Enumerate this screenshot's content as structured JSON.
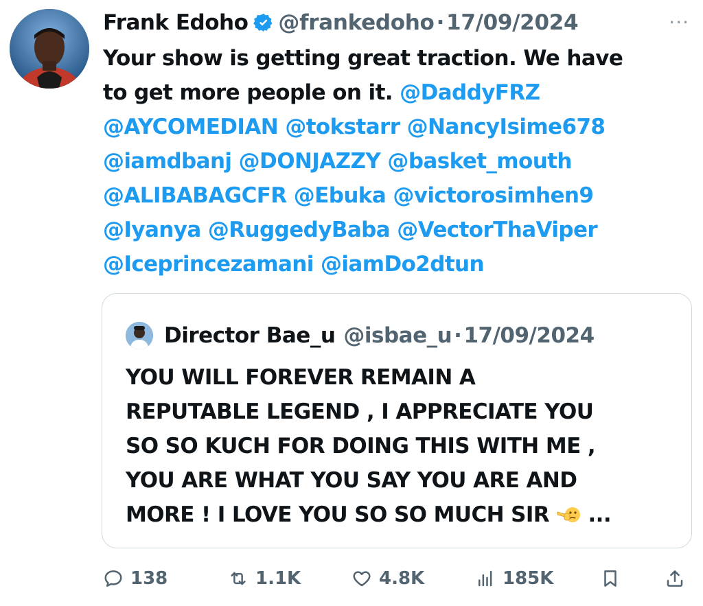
{
  "tweet": {
    "author_name": "Frank Edoho",
    "author_handle": "@frankedoho",
    "separator": "·",
    "date": "17/09/2024",
    "more_label": "···",
    "lines": [
      [
        {
          "t": "Your show is getting great traction. We have",
          "m": false
        }
      ],
      [
        {
          "t": "to get more people on it. ",
          "m": false
        },
        {
          "t": "@DaddyFRZ",
          "m": true
        }
      ],
      [
        {
          "t": "@AYCOMEDIAN",
          "m": true
        },
        {
          "t": " ",
          "m": false
        },
        {
          "t": "@tokstarr",
          "m": true
        },
        {
          "t": " ",
          "m": false
        },
        {
          "t": "@NancyIsime678",
          "m": true
        }
      ],
      [
        {
          "t": "@iamdbanj",
          "m": true
        },
        {
          "t": " ",
          "m": false
        },
        {
          "t": "@DONJAZZY",
          "m": true
        },
        {
          "t": " ",
          "m": false
        },
        {
          "t": "@basket_mouth",
          "m": true
        }
      ],
      [
        {
          "t": "@ALIBABAGCFR",
          "m": true
        },
        {
          "t": " ",
          "m": false
        },
        {
          "t": "@Ebuka",
          "m": true
        },
        {
          "t": " ",
          "m": false
        },
        {
          "t": "@victorosimhen9",
          "m": true
        }
      ],
      [
        {
          "t": "@Iyanya",
          "m": true
        },
        {
          "t": " ",
          "m": false
        },
        {
          "t": "@RuggedyBaba",
          "m": true
        },
        {
          "t": " ",
          "m": false
        },
        {
          "t": "@VectorThaViper",
          "m": true
        }
      ],
      [
        {
          "t": "@Iceprincezamani",
          "m": true
        },
        {
          "t": " ",
          "m": false
        },
        {
          "t": "@iamDo2dtun",
          "m": true
        }
      ]
    ]
  },
  "quoted": {
    "author_name": "Director Bae_u",
    "author_handle": "@isbae_u",
    "separator": "·",
    "date": "17/09/2024",
    "lines": [
      "YOU WILL FOREVER REMAIN A",
      "REPUTABLE LEGEND , I APPRECIATE YOU",
      "SO SO KUCH FOR DOING THIS WITH ME ,",
      "YOU ARE WHAT YOU SAY YOU ARE AND",
      "MORE ! I LOVE YOU SO SO MUCH SIR"
    ],
    "ellipsis": "...",
    "emoji": "pointing-finger-emoji"
  },
  "actions": {
    "replies": "138",
    "reposts": "1.1K",
    "likes": "4.8K",
    "views": "185K"
  },
  "colors": {
    "link": "#1d9bf0",
    "text": "#0f1419",
    "secondary": "#536471",
    "border": "#cfd9de"
  }
}
